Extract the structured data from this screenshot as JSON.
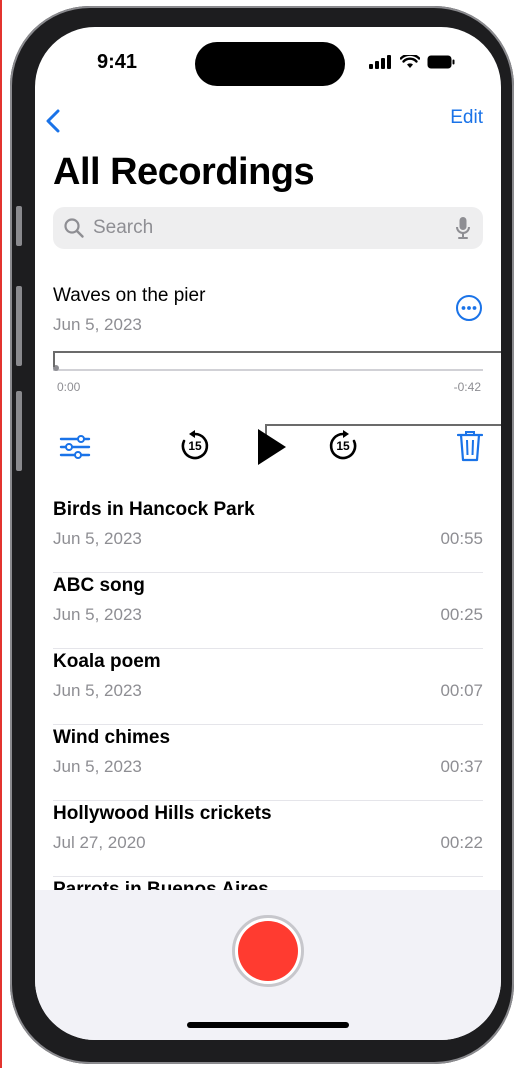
{
  "status_bar": {
    "time": "9:41"
  },
  "nav": {
    "edit_label": "Edit"
  },
  "header": {
    "title": "All Recordings"
  },
  "search": {
    "placeholder": "Search"
  },
  "current_recording": {
    "title": "Waves on the pier",
    "date": "Jun 5, 2023",
    "elapsed": "0:00",
    "remaining": "-0:42",
    "progress": 0.0
  },
  "controls": {
    "skip_back_label": "15",
    "skip_forward_label": "15"
  },
  "recordings": [
    {
      "name": "Birds in Hancock Park",
      "date": "Jun 5, 2023",
      "duration": "00:55"
    },
    {
      "name": "ABC song",
      "date": "Jun 5, 2023",
      "duration": "00:25"
    },
    {
      "name": "Koala poem",
      "date": "Jun 5, 2023",
      "duration": "00:07"
    },
    {
      "name": "Wind chimes",
      "date": "Jun 5, 2023",
      "duration": "00:37"
    },
    {
      "name": "Hollywood Hills crickets",
      "date": "Jul 27, 2020",
      "duration": "00:22"
    },
    {
      "name": "Parrots in Buenos Aires"
    }
  ],
  "colors": {
    "accent": "#1a73e8",
    "record": "#ff3b30"
  }
}
